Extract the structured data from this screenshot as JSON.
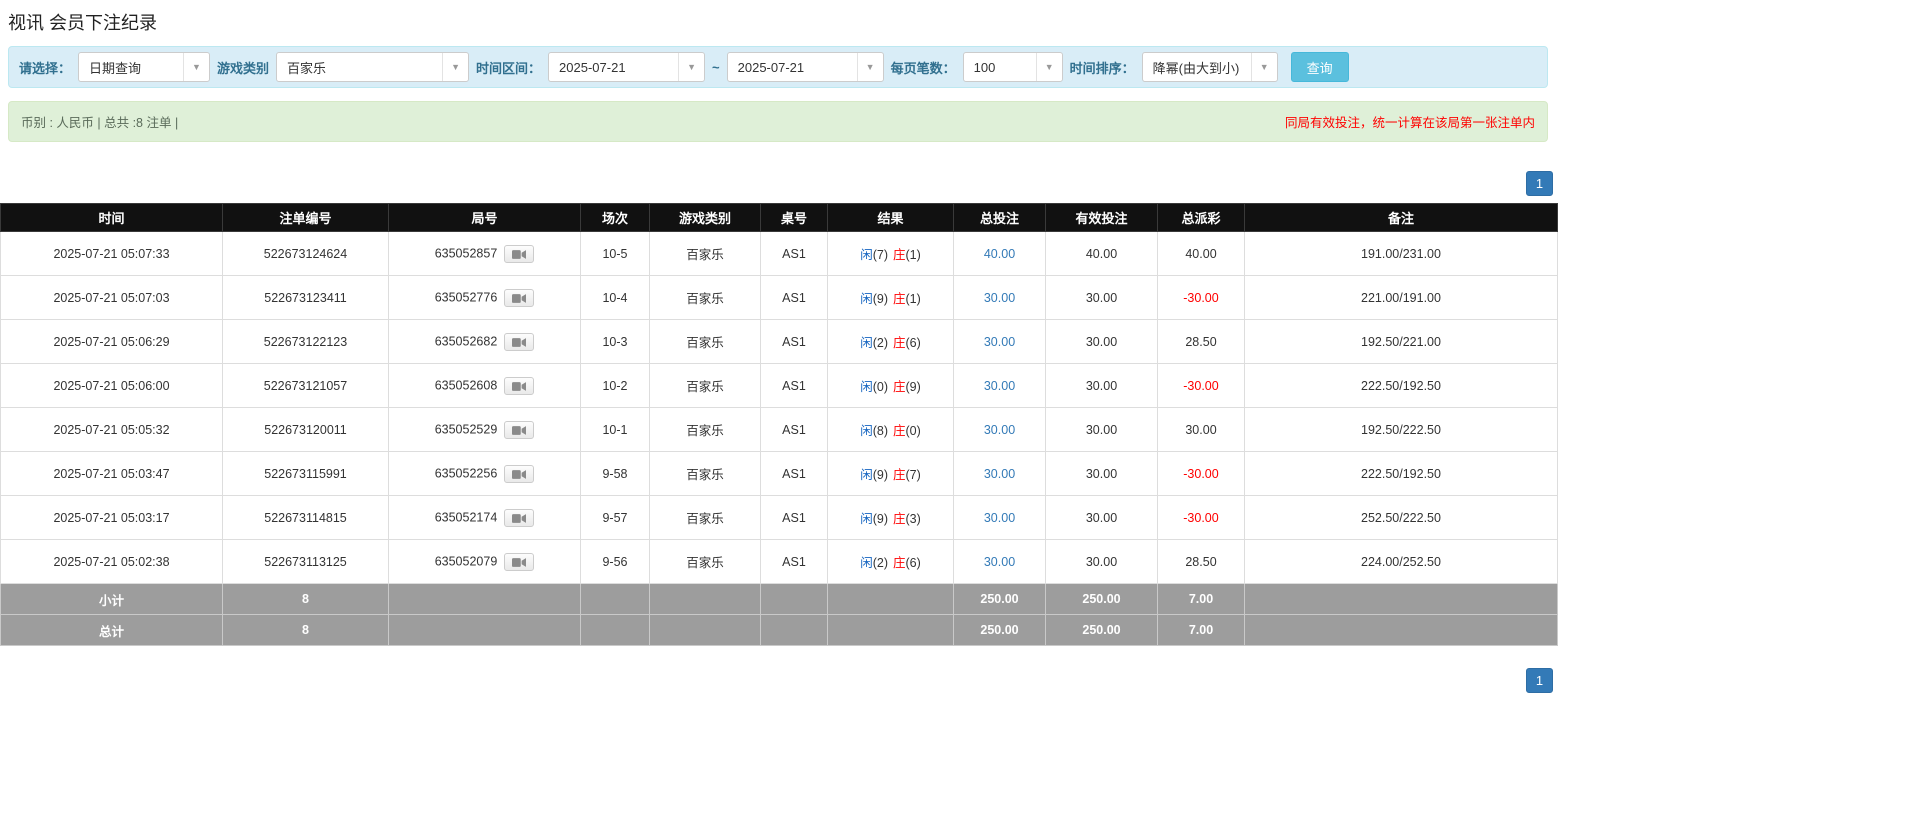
{
  "page_title": "视讯 会员下注纪录",
  "filter_bar": {
    "select_label": "请选择：",
    "select_value": "日期查询",
    "game_type_label": "游戏类别",
    "game_type_value": "百家乐",
    "time_range_label": "时间区间：",
    "time_from": "2025-07-21",
    "range_separator": "~",
    "time_to": "2025-07-21",
    "page_size_label": "每页笔数：",
    "page_size_value": "100",
    "sort_label": "时间排序：",
    "sort_value": "降幂(由大到小)",
    "query_button": "查询"
  },
  "info_bar": {
    "summary": "币别 : 人民币 | 总共 :8 注单 |",
    "notice": "同局有效投注，统一计算在该局第一张注单内"
  },
  "pagination": {
    "page": "1"
  },
  "table": {
    "headers": [
      "时间",
      "注单编号",
      "局号",
      "场次",
      "游戏类别",
      "桌号",
      "结果",
      "总投注",
      "有效投注",
      "总派彩",
      "备注"
    ],
    "rows": [
      {
        "time": "2025-07-21 05:07:33",
        "bet_id": "522673124624",
        "round_id": "635052857",
        "session": "10-5",
        "game": "百家乐",
        "table_no": "AS1",
        "player": "闲",
        "player_n": "(7)",
        "banker": "庄",
        "banker_n": "(1)",
        "total_bet": "40.00",
        "valid_bet": "40.00",
        "payout": "40.00",
        "remark": "191.00/231.00"
      },
      {
        "time": "2025-07-21 05:07:03",
        "bet_id": "522673123411",
        "round_id": "635052776",
        "session": "10-4",
        "game": "百家乐",
        "table_no": "AS1",
        "player": "闲",
        "player_n": "(9)",
        "banker": "庄",
        "banker_n": "(1)",
        "total_bet": "30.00",
        "valid_bet": "30.00",
        "payout": "-30.00",
        "remark": "221.00/191.00"
      },
      {
        "time": "2025-07-21 05:06:29",
        "bet_id": "522673122123",
        "round_id": "635052682",
        "session": "10-3",
        "game": "百家乐",
        "table_no": "AS1",
        "player": "闲",
        "player_n": "(2)",
        "banker": "庄",
        "banker_n": "(6)",
        "total_bet": "30.00",
        "valid_bet": "30.00",
        "payout": "28.50",
        "remark": "192.50/221.00"
      },
      {
        "time": "2025-07-21 05:06:00",
        "bet_id": "522673121057",
        "round_id": "635052608",
        "session": "10-2",
        "game": "百家乐",
        "table_no": "AS1",
        "player": "闲",
        "player_n": "(0)",
        "banker": "庄",
        "banker_n": "(9)",
        "total_bet": "30.00",
        "valid_bet": "30.00",
        "payout": "-30.00",
        "remark": "222.50/192.50"
      },
      {
        "time": "2025-07-21 05:05:32",
        "bet_id": "522673120011",
        "round_id": "635052529",
        "session": "10-1",
        "game": "百家乐",
        "table_no": "AS1",
        "player": "闲",
        "player_n": "(8)",
        "banker": "庄",
        "banker_n": "(0)",
        "total_bet": "30.00",
        "valid_bet": "30.00",
        "payout": "30.00",
        "remark": "192.50/222.50"
      },
      {
        "time": "2025-07-21 05:03:47",
        "bet_id": "522673115991",
        "round_id": "635052256",
        "session": "9-58",
        "game": "百家乐",
        "table_no": "AS1",
        "player": "闲",
        "player_n": "(9)",
        "banker": "庄",
        "banker_n": "(7)",
        "total_bet": "30.00",
        "valid_bet": "30.00",
        "payout": "-30.00",
        "remark": "222.50/192.50"
      },
      {
        "time": "2025-07-21 05:03:17",
        "bet_id": "522673114815",
        "round_id": "635052174",
        "session": "9-57",
        "game": "百家乐",
        "table_no": "AS1",
        "player": "闲",
        "player_n": "(9)",
        "banker": "庄",
        "banker_n": "(3)",
        "total_bet": "30.00",
        "valid_bet": "30.00",
        "payout": "-30.00",
        "remark": "252.50/222.50"
      },
      {
        "time": "2025-07-21 05:02:38",
        "bet_id": "522673113125",
        "round_id": "635052079",
        "session": "9-56",
        "game": "百家乐",
        "table_no": "AS1",
        "player": "闲",
        "player_n": "(2)",
        "banker": "庄",
        "banker_n": "(6)",
        "total_bet": "30.00",
        "valid_bet": "30.00",
        "payout": "28.50",
        "remark": "224.00/252.50"
      }
    ],
    "subtotal": {
      "label": "小计",
      "count": "8",
      "total_bet": "250.00",
      "valid_bet": "250.00",
      "payout": "7.00"
    },
    "total": {
      "label": "总计",
      "count": "8",
      "total_bet": "250.00",
      "valid_bet": "250.00",
      "payout": "7.00"
    }
  },
  "icons": {
    "chevron_down": "chevron-down-icon",
    "video_replay": "video-camera-icon"
  },
  "colors": {
    "accent_blue": "#337ab7",
    "player_blue": "#1464c0",
    "banker_red": "#ff0000",
    "negative_red": "#ff0000",
    "query_button_bg": "#5bc0de",
    "filter_bar_bg": "#d9edf7",
    "info_bar_bg": "#dff0d8",
    "header_bg": "#111111",
    "footer_row_bg": "#9d9d9d"
  }
}
